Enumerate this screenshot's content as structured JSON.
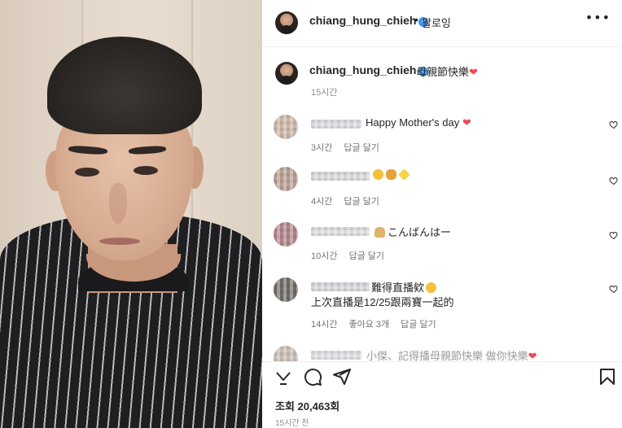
{
  "post": {
    "username": "chiang_hung_chieh",
    "verified_glyph": "✓",
    "separator": "•",
    "follow_label": "팔로잉",
    "more_icon": "more-horizontal-icon",
    "caption_text": "母親節快樂",
    "caption_heart": "❤",
    "caption_time": "15시간"
  },
  "comments": [
    {
      "text": "Happy Mother's day",
      "heart": "❤",
      "line2": "",
      "time": "3시간",
      "likes": "",
      "reply": "답글 달기",
      "avatar_color": "#c9b4a4",
      "name_color": "#d8d8dc"
    },
    {
      "text": "",
      "emoji": [
        "😊",
        "💐",
        "✨"
      ],
      "line2": "",
      "time": "4시간",
      "likes": "",
      "reply": "답글 달기",
      "avatar_color": "#b79d90",
      "name_color": "#d6d6da"
    },
    {
      "text": "こんばんはー",
      "line2": "",
      "time": "10시간",
      "likes": "",
      "reply": "답글 달기",
      "avatar_color": "#b0828a",
      "name_color": "#dadade"
    },
    {
      "text": "難得直播欸",
      "line2": "上次直播是12/25跟兩寶一起的",
      "time": "14시간",
      "likes": "좋아요 3개",
      "reply": "답글 달기",
      "avatar_color": "#6f6a66",
      "name_color": "#d4d4d8"
    },
    {
      "text": "小傑、記得播母親節快樂 做你快樂",
      "line2": "",
      "time": "",
      "likes": "",
      "reply": "",
      "avatar_color": "#c7bcb3",
      "name_color": "#dcdce0"
    }
  ],
  "footer": {
    "views": "조회 20,463회",
    "ago": "15시간 전"
  },
  "icons": {
    "like": "chevron-down-icon",
    "comment": "comment-icon",
    "share": "send-icon",
    "save": "bookmark-icon"
  },
  "colors": {
    "verified": "#3897f0",
    "heart": "#ed4956",
    "meta": "#737373"
  }
}
